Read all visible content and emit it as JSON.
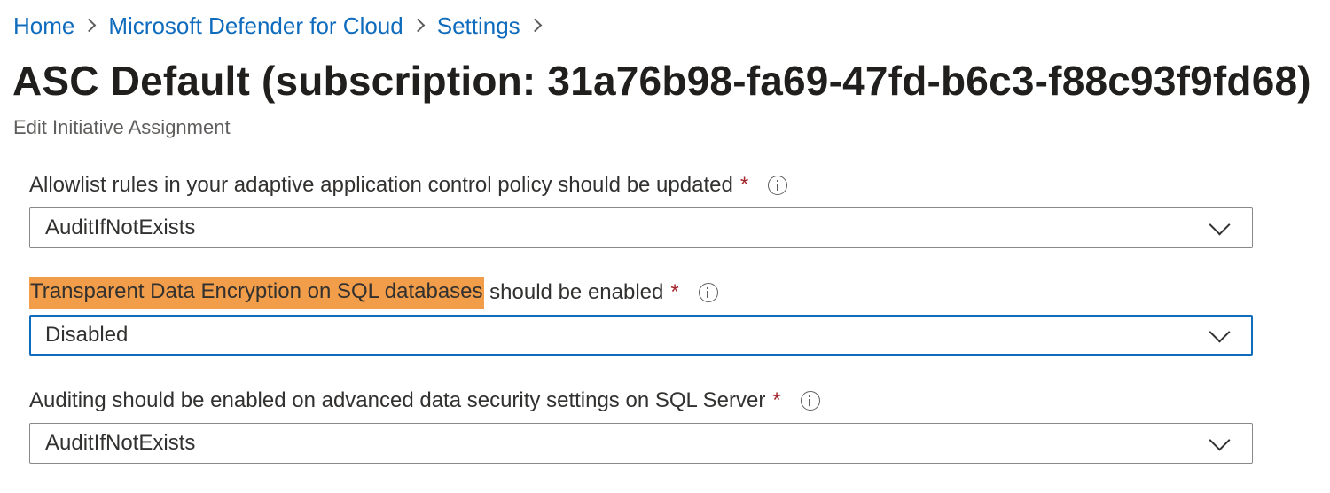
{
  "breadcrumb": {
    "items": [
      {
        "label": "Home"
      },
      {
        "label": "Microsoft Defender for Cloud"
      },
      {
        "label": "Settings"
      }
    ]
  },
  "page": {
    "title": "ASC Default (subscription: 31a76b98-fa69-47fd-b6c3-f88c93f9fd68)",
    "subtitle": "Edit Initiative Assignment"
  },
  "fields": [
    {
      "label": "Allowlist rules in your adaptive application control policy should be updated",
      "required_mark": "*",
      "value": "AuditIfNotExists"
    },
    {
      "label_highlight": "Transparent Data Encryption on SQL databases",
      "label_rest": " should be enabled",
      "required_mark": "*",
      "value": "Disabled"
    },
    {
      "label": "Auditing should be enabled on advanced data security settings on SQL Server",
      "required_mark": "*",
      "value": "AuditIfNotExists"
    }
  ],
  "colors": {
    "link": "#0f6cbd",
    "highlight": "#f29d4a",
    "required": "#a4262c",
    "focus_border": "#0f6cbd"
  },
  "icons": {
    "breadcrumb_separator": "chevron-right-icon",
    "info": "info-icon",
    "dropdown": "chevron-down-icon"
  }
}
